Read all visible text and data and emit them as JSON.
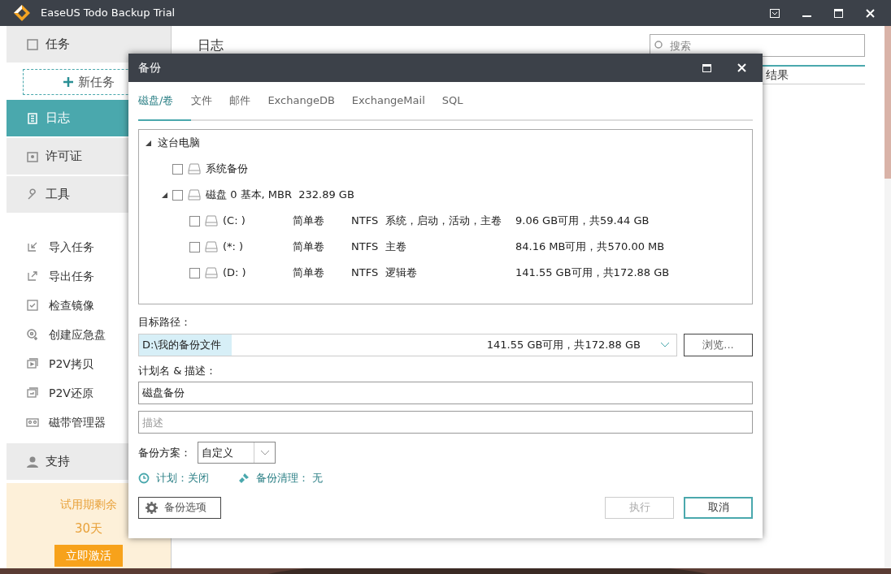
{
  "window": {
    "title": "EaseUS Todo Backup Trial"
  },
  "sidebar": {
    "items": [
      {
        "kind": "header",
        "label": "任务",
        "selected": false
      },
      {
        "kind": "new",
        "label": "新任务",
        "selected": false
      },
      {
        "kind": "header",
        "label": "日志",
        "selected": true
      },
      {
        "kind": "header",
        "label": "许可证",
        "selected": false
      },
      {
        "kind": "header",
        "label": "工具",
        "selected": false
      },
      {
        "kind": "tool",
        "label": "导入任务",
        "selected": false
      },
      {
        "kind": "tool",
        "label": "导出任务",
        "selected": false
      },
      {
        "kind": "tool",
        "label": "检查镜像",
        "selected": false
      },
      {
        "kind": "tool",
        "label": "创建应急盘",
        "selected": false
      },
      {
        "kind": "tool",
        "label": "P2V拷贝",
        "selected": false
      },
      {
        "kind": "tool",
        "label": "P2V还原",
        "selected": false
      },
      {
        "kind": "tool",
        "label": "磁带管理器",
        "selected": false
      },
      {
        "kind": "header",
        "label": "支持",
        "selected": false
      }
    ],
    "trial": {
      "text": "试用期剩余",
      "days": "30天",
      "button": "立即激活"
    }
  },
  "main": {
    "title": "日志",
    "search": {
      "placeholder": "搜索"
    },
    "columns": [
      "结果"
    ]
  },
  "dialog": {
    "title": "备份",
    "tabs": [
      {
        "label": "磁盘/卷",
        "selected": true
      },
      {
        "label": "文件",
        "selected": false
      },
      {
        "label": "邮件",
        "selected": false
      },
      {
        "label": "ExchangeDB",
        "selected": false
      },
      {
        "label": "ExchangeMail",
        "selected": false
      },
      {
        "label": "SQL",
        "selected": false
      }
    ],
    "tree": {
      "label": "这台电脑",
      "expanded": true,
      "children": [
        {
          "label": "系统备份",
          "checked": false
        },
        {
          "label": "磁盘 0 基本, MBR  232.89 GB",
          "checked": false,
          "expanded": true,
          "children": [
            {
              "label": "(C: )",
              "checked": false,
              "type": "简单卷",
              "fs": "NTFS",
              "flags": "系统，启动，活动，主卷",
              "space": "9.06 GB可用，共59.44 GB"
            },
            {
              "label": "(*: )",
              "checked": false,
              "type": "简单卷",
              "fs": "NTFS",
              "flags": "主卷",
              "space": "84.16 MB可用，共570.00 MB"
            },
            {
              "label": "(D: )",
              "checked": false,
              "type": "简单卷",
              "fs": "NTFS",
              "flags": "逻辑卷",
              "space": "141.55 GB可用，共172.88 GB"
            }
          ]
        }
      ]
    },
    "target": {
      "label": "目标路径：",
      "value": "D:\\我的备份文件",
      "space": "141.55 GB可用，共172.88 GB",
      "browse": "浏览..."
    },
    "plan": {
      "label": "计划名 & 描述：",
      "name": "磁盘备份",
      "description_placeholder": "描述"
    },
    "scheme": {
      "label": "备份方案：",
      "value": "自定义"
    },
    "schedule": "计划：关闭",
    "cleanup": "备份清理： 无",
    "options_button": "备份选项",
    "buttons": [
      {
        "label": "执行",
        "disabled": true
      },
      {
        "label": "取消",
        "disabled": false
      }
    ]
  }
}
